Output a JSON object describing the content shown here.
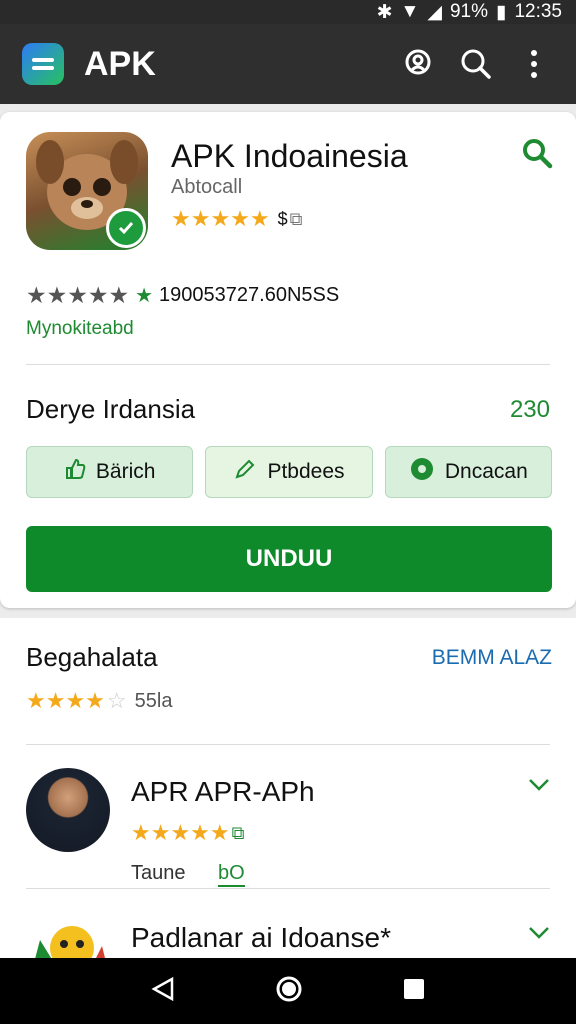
{
  "status": {
    "battery": "91%",
    "time": "12:35"
  },
  "appbar": {
    "title": "APK"
  },
  "app": {
    "name": "APK Indoainesia",
    "developer": "Abtocall",
    "rating_extra": "$",
    "stats": "190053727.60N5SS",
    "link": "Mynokiteabd"
  },
  "section": {
    "title": "Derye Irdansia",
    "count": "230"
  },
  "chips": [
    {
      "label": "Bärich"
    },
    {
      "label": "Ptbdees"
    },
    {
      "label": "Dncacan"
    }
  ],
  "install": {
    "label": "UNDUU"
  },
  "reviews": {
    "title": "Begahalata",
    "see_all": "BEMM ALAZ",
    "rating_text": "55la",
    "items": [
      {
        "name": "APR APR-APh",
        "tag": "Taune",
        "tag2": "bO"
      },
      {
        "name": "Padlanar ai Idoanse*"
      }
    ]
  },
  "colors": {
    "accent": "#0e8a2a",
    "star": "#f4a91c",
    "link": "#1b6bb0"
  }
}
